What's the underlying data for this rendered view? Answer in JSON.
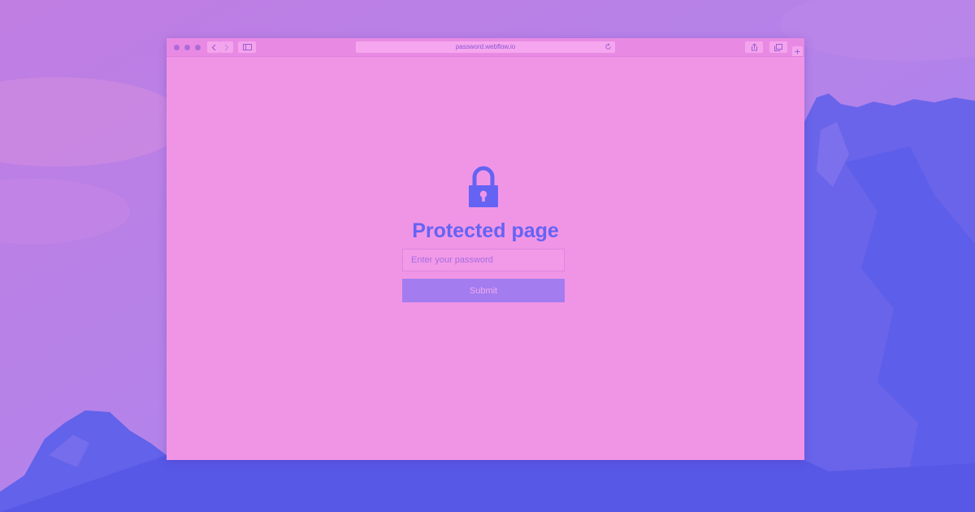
{
  "colors": {
    "sky": "#b07ee6",
    "mountain": "#5a5ce8",
    "page_background": "#f095e6",
    "accent": "#6563f3",
    "button_background": "#a37cf0",
    "button_text": "#f0a8f0"
  },
  "browser": {
    "url": "password.webflow.io",
    "icons": [
      "close-dot",
      "minimize-dot",
      "maximize-dot",
      "chevron-left-icon",
      "chevron-right-icon",
      "sidebar-icon",
      "reload-icon",
      "share-icon",
      "tabs-icon",
      "plus-icon"
    ]
  },
  "page": {
    "icon": "lock-icon",
    "title": "Protected page",
    "password_placeholder": "Enter your password",
    "submit_label": "Submit"
  }
}
